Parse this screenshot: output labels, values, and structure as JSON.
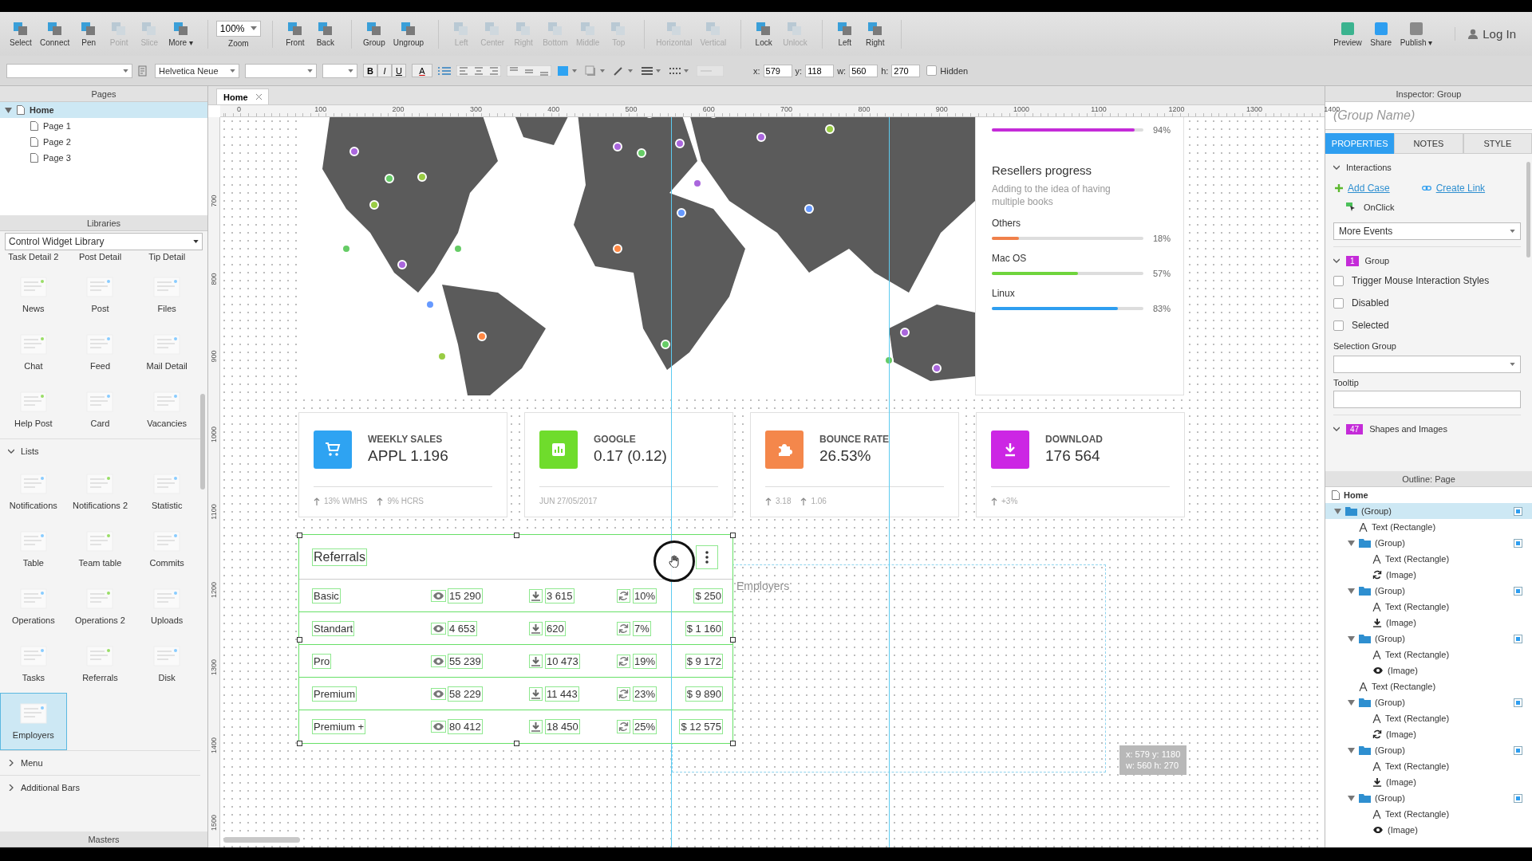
{
  "toolbar": {
    "groups": [
      {
        "kind": "tools",
        "tools": [
          {
            "label": "Select",
            "disabled": false
          },
          {
            "label": "Connect",
            "disabled": false
          },
          {
            "label": "Pen",
            "disabled": false
          },
          {
            "label": "Point",
            "disabled": true
          },
          {
            "label": "Slice",
            "disabled": true
          },
          {
            "label": "More ▾",
            "disabled": false
          }
        ]
      },
      {
        "kind": "zoom",
        "value": "100%",
        "label": "Zoom"
      },
      {
        "kind": "tools",
        "tools": [
          {
            "label": "Front",
            "disabled": false
          },
          {
            "label": "Back",
            "disabled": false
          }
        ]
      },
      {
        "kind": "tools",
        "tools": [
          {
            "label": "Group",
            "disabled": false
          },
          {
            "label": "Ungroup",
            "disabled": false
          }
        ]
      },
      {
        "kind": "tools",
        "tools": [
          {
            "label": "Left",
            "disabled": true
          },
          {
            "label": "Center",
            "disabled": true
          },
          {
            "label": "Right",
            "disabled": true
          },
          {
            "label": "Bottom",
            "disabled": true
          },
          {
            "label": "Middle",
            "disabled": true
          },
          {
            "label": "Top",
            "disabled": true
          }
        ]
      },
      {
        "kind": "tools",
        "tools": [
          {
            "label": "Horizontal",
            "disabled": true
          },
          {
            "label": "Vertical",
            "disabled": true
          }
        ]
      },
      {
        "kind": "tools",
        "tools": [
          {
            "label": "Lock",
            "disabled": false
          },
          {
            "label": "Unlock",
            "disabled": true
          }
        ]
      },
      {
        "kind": "tools",
        "tools": [
          {
            "label": "Left",
            "disabled": false
          },
          {
            "label": "Right",
            "disabled": false
          }
        ]
      }
    ],
    "right_tools": [
      {
        "label": "Preview",
        "disabled": false
      },
      {
        "label": "Share",
        "disabled": false
      },
      {
        "label": "Publish ▾",
        "disabled": false
      }
    ],
    "login": "Log In"
  },
  "format_bar": {
    "font": "Helvetica Neue",
    "style_buttons": [
      "B",
      "I",
      "U"
    ],
    "font_color": "A",
    "fields": [
      {
        "label": "x:",
        "value": "579"
      },
      {
        "label": "y:",
        "value": "118"
      },
      {
        "label": "w:",
        "value": "560"
      },
      {
        "label": "h:",
        "value": "270"
      }
    ],
    "hidden": {
      "label": "Hidden",
      "checked": false
    }
  },
  "pages": {
    "title": "Pages",
    "root": {
      "label": "Home",
      "selected": true,
      "expanded": true,
      "children": [
        {
          "label": "Page 1",
          "selected": false
        },
        {
          "label": "Page 2",
          "selected": false
        },
        {
          "label": "Page 3",
          "selected": false
        }
      ]
    }
  },
  "libraries": {
    "title": "Libraries",
    "library": "Control Widget Library",
    "partial_row": [
      "Task Detail 2",
      "Post Detail",
      "Tip Detail"
    ],
    "widgets": [
      {
        "label": "News",
        "selected": false
      },
      {
        "label": "Post",
        "selected": false
      },
      {
        "label": "Files",
        "selected": false
      },
      {
        "label": "Chat",
        "selected": false
      },
      {
        "label": "Feed",
        "selected": false
      },
      {
        "label": "Mail Detail",
        "selected": false
      },
      {
        "label": "Help Post",
        "selected": false
      },
      {
        "label": "Card",
        "selected": false
      },
      {
        "label": "Vacancies",
        "selected": false
      }
    ],
    "sections": [
      {
        "label": "Lists",
        "expanded": true,
        "widgets": [
          {
            "label": "Notifications",
            "selected": false
          },
          {
            "label": "Notifications 2",
            "selected": false
          },
          {
            "label": "Statistic",
            "selected": false
          },
          {
            "label": "Table",
            "selected": false
          },
          {
            "label": "Team table",
            "selected": false
          },
          {
            "label": "Commits",
            "selected": false
          },
          {
            "label": "Operations",
            "selected": false
          },
          {
            "label": "Operations 2",
            "selected": false
          },
          {
            "label": "Uploads",
            "selected": false
          },
          {
            "label": "Tasks",
            "selected": false
          },
          {
            "label": "Referrals",
            "selected": false
          },
          {
            "label": "Disk",
            "selected": false
          },
          {
            "label": "Employers",
            "selected": true
          }
        ]
      },
      {
        "label": "Menu",
        "expanded": false
      },
      {
        "label": "Additional Bars",
        "expanded": false
      }
    ]
  },
  "masters": {
    "title": "Masters"
  },
  "tabs": [
    {
      "label": "Home",
      "selected": true
    }
  ],
  "ruler": {
    "x_labels": [
      "0",
      "100",
      "200",
      "300",
      "400",
      "500",
      "600",
      "700",
      "800",
      "900",
      "1000",
      "1100",
      "1200",
      "1300",
      "1400"
    ],
    "y_labels": [
      "700",
      "800",
      "900",
      "1000",
      "1100",
      "1200",
      "1300",
      "1400",
      "1500"
    ]
  },
  "resellers": {
    "top_bar": {
      "level": 0.94,
      "reading": "94%",
      "color": "#c42bd8"
    },
    "title": "Resellers progress",
    "subtitle": "Adding to the idea of having multiple books",
    "bars": [
      {
        "label": "Others",
        "level": 0.18,
        "reading": "18%",
        "color": "#f0804a"
      },
      {
        "label": "Mac OS",
        "level": 0.57,
        "reading": "57%",
        "color": "#6fd43c"
      },
      {
        "label": "Linux",
        "level": 0.83,
        "reading": "83%",
        "color": "#2e9ef0"
      }
    ]
  },
  "stat_cards": [
    {
      "title": "WEEKLY SALES",
      "value": "APPL 1.196",
      "color": "#2ea3f2",
      "footer": [
        {
          "kind": "up",
          "text": "13% WMHS"
        },
        {
          "kind": "up",
          "text": "9% HCRS"
        }
      ]
    },
    {
      "title": "GOOGLE",
      "value": "0.17 (0.12)",
      "color": "#6fdc2c",
      "footer": [
        {
          "kind": "plain",
          "text": "JUN 27/05/2017"
        }
      ]
    },
    {
      "title": "BOUNCE RATE",
      "value": "26.53%",
      "color": "#f4874b",
      "footer": [
        {
          "kind": "up",
          "text": "3.18"
        },
        {
          "kind": "up",
          "text": "1.06"
        }
      ]
    },
    {
      "title": "DOWNLOAD",
      "value": "176 564",
      "color": "#cc26e4",
      "footer": [
        {
          "kind": "up",
          "text": "+3%"
        }
      ]
    }
  ],
  "referrals": {
    "title": "Referrals",
    "rows": [
      {
        "name": "Basic",
        "views": "15 290",
        "downloads": "3 615",
        "rate": "10%",
        "price": "$ 250"
      },
      {
        "name": "Standart",
        "views": "4 653",
        "downloads": "620",
        "rate": "7%",
        "price": "$ 1 160"
      },
      {
        "name": "Pro",
        "views": "55 239",
        "downloads": "10 473",
        "rate": "19%",
        "price": "$ 9 172"
      },
      {
        "name": "Premium",
        "views": "58 229",
        "downloads": "11 443",
        "rate": "23%",
        "price": "$ 9 890"
      },
      {
        "name": "Premium +",
        "views": "80 412",
        "downloads": "18 450",
        "rate": "25%",
        "price": "$ 12 575"
      }
    ]
  },
  "drag_preview": {
    "title": "Employers"
  },
  "size_tooltip": {
    "line_1": "x: 579  y: 1180",
    "line_2": "w: 560  h: 270"
  },
  "inspector": {
    "title": "Inspector: Group",
    "name_placeholder": "(Group Name)",
    "tabs": [
      {
        "label": "PROPERTIES",
        "selected": true
      },
      {
        "label": "NOTES",
        "selected": false
      },
      {
        "label": "STYLE",
        "selected": false
      }
    ],
    "interactions": {
      "label": "Interactions",
      "expanded": true,
      "add_case": "Add Case",
      "create_link": "Create Link",
      "event": "OnClick",
      "more_events": "More Events"
    },
    "group": {
      "badge": "1",
      "label": "Group",
      "expanded": true,
      "checkboxes": [
        {
          "label": "Trigger Mouse Interaction Styles",
          "checked": false
        },
        {
          "label": "Disabled",
          "checked": false
        },
        {
          "label": "Selected",
          "checked": false
        }
      ],
      "selection_group_label": "Selection Group",
      "tooltip_label": "Tooltip"
    },
    "shapes": {
      "badge": "47",
      "label": "Shapes and Images",
      "expanded": true
    }
  },
  "outline": {
    "title": "Outline: Page",
    "root": "Home",
    "items": [
      {
        "label": "(Group)",
        "kind": "group",
        "selected": true,
        "expanded": true,
        "children": [
          {
            "label": "Text (Rectangle)",
            "kind": "text",
            "selected": false
          },
          {
            "label": "(Group)",
            "kind": "group",
            "selected": false,
            "expanded": true,
            "children": [
              {
                "label": "Text (Rectangle)",
                "kind": "text",
                "selected": false
              },
              {
                "label": "(Image)",
                "kind": "image-refresh",
                "selected": false
              }
            ]
          },
          {
            "label": "(Group)",
            "kind": "group",
            "selected": false,
            "expanded": true,
            "children": [
              {
                "label": "Text (Rectangle)",
                "kind": "text",
                "selected": false
              },
              {
                "label": "(Image)",
                "kind": "image-download",
                "selected": false
              }
            ]
          },
          {
            "label": "(Group)",
            "kind": "group",
            "selected": false,
            "expanded": true,
            "children": [
              {
                "label": "Text (Rectangle)",
                "kind": "text",
                "selected": false
              },
              {
                "label": "(Image)",
                "kind": "image-eye",
                "selected": false
              }
            ]
          },
          {
            "label": "Text (Rectangle)",
            "kind": "text",
            "selected": false
          },
          {
            "label": "(Group)",
            "kind": "group",
            "selected": false,
            "expanded": true,
            "children": [
              {
                "label": "Text (Rectangle)",
                "kind": "text",
                "selected": false
              },
              {
                "label": "(Image)",
                "kind": "image-refresh",
                "selected": false
              }
            ]
          },
          {
            "label": "(Group)",
            "kind": "group",
            "selected": false,
            "expanded": true,
            "children": [
              {
                "label": "Text (Rectangle)",
                "kind": "text",
                "selected": false
              },
              {
                "label": "(Image)",
                "kind": "image-download",
                "selected": false
              }
            ]
          },
          {
            "label": "(Group)",
            "kind": "group",
            "selected": false,
            "expanded": true,
            "children": [
              {
                "label": "Text (Rectangle)",
                "kind": "text",
                "selected": false
              },
              {
                "label": "(Image)",
                "kind": "image-eye",
                "selected": false
              }
            ]
          }
        ]
      }
    ]
  }
}
